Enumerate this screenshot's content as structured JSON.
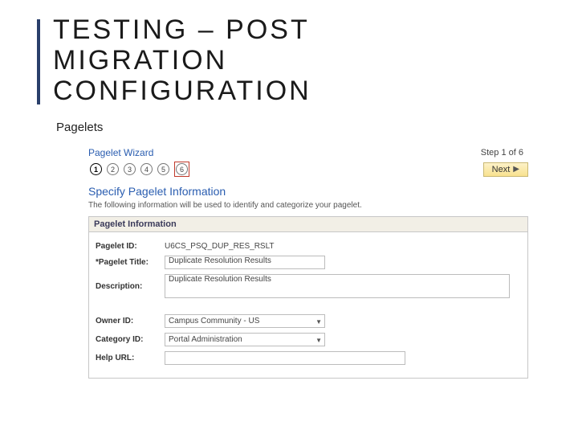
{
  "title_lines": [
    "TESTING – POST",
    "MIGRATION",
    "CONFIGURATION"
  ],
  "subhead": "Pagelets",
  "wizard": {
    "title": "Pagelet Wizard",
    "step_of": "Step 1 of 6",
    "steps": [
      "1",
      "2",
      "3",
      "4",
      "5",
      "6"
    ],
    "current_step": "1",
    "highlighted_step": "6",
    "next_label": "Next"
  },
  "section": {
    "heading": "Specify Pagelet Information",
    "desc": "The following information will be used to identify and categorize your pagelet."
  },
  "panel": {
    "header": "Pagelet Information",
    "fields": {
      "pagelet_id_label": "Pagelet ID:",
      "pagelet_id_value": "U6CS_PSQ_DUP_RES_RSLT",
      "pagelet_title_label": "*Pagelet Title:",
      "pagelet_title_value": "Duplicate Resolution Results",
      "description_label": "Description:",
      "description_value": "Duplicate Resolution Results",
      "owner_id_label": "Owner ID:",
      "owner_id_value": "Campus Community - US",
      "category_id_label": "Category ID:",
      "category_id_value": "Portal Administration",
      "help_url_label": "Help URL:",
      "help_url_value": ""
    }
  }
}
